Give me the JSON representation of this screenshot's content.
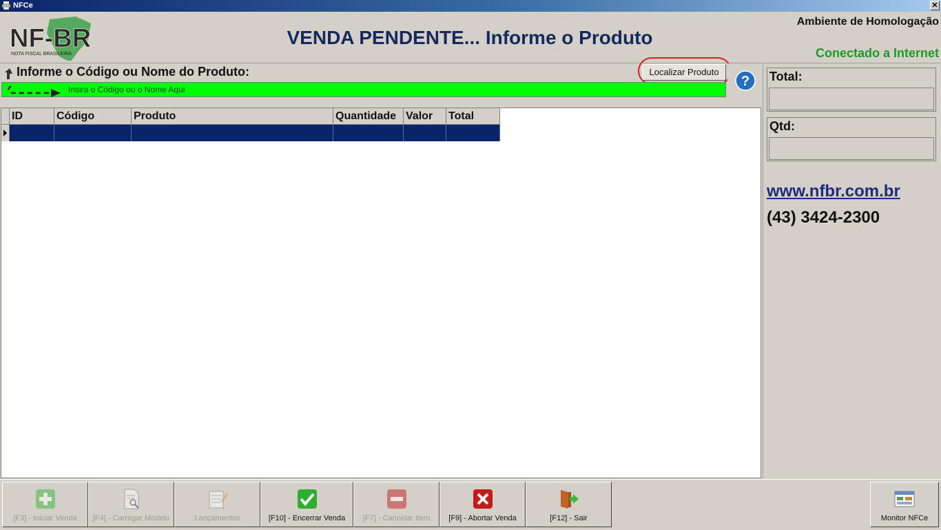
{
  "window": {
    "title": "NFCe",
    "close_glyph": "✕"
  },
  "header": {
    "logo_text": "NF-BR",
    "logo_subtext": "NOTA FISCAL BRASILEIRA",
    "title": "VENDA PENDENTE... Informe o Produto",
    "environment": "Ambiente de Homologação",
    "connection": "Conectado a Internet"
  },
  "search": {
    "label": "Informe o Código ou Nome do Produto:",
    "placeholder": "Insira o Código ou o Nome Aqui",
    "value": "",
    "locate_button": "Localizar Produto",
    "help_glyph": "?"
  },
  "grid": {
    "columns": [
      {
        "key": "id",
        "label": "ID"
      },
      {
        "key": "codigo",
        "label": "Código"
      },
      {
        "key": "produto",
        "label": "Produto"
      },
      {
        "key": "quantidade",
        "label": "Quantidade"
      },
      {
        "key": "valor",
        "label": "Valor"
      },
      {
        "key": "total",
        "label": "Total"
      }
    ],
    "rows": [
      {
        "id": "",
        "codigo": "",
        "produto": "",
        "quantidade": "",
        "valor": "",
        "total": ""
      }
    ]
  },
  "summary": {
    "total_label": "Total:",
    "total_value": "",
    "qtd_label": "Qtd:",
    "qtd_value": "",
    "website": "www.nfbr.com.br",
    "phone": "(43) 3424-2300"
  },
  "toolbar": {
    "buttons": [
      {
        "label": "[F3] - Iniciar Venda",
        "icon": "plus-icon",
        "enabled": false
      },
      {
        "label": "[F4] - Carregar Modelo",
        "icon": "document-search-icon",
        "enabled": false
      },
      {
        "label": "Lançamentos",
        "icon": "edit-list-icon",
        "enabled": false
      },
      {
        "label": "[F10] - Encerrar Venda",
        "icon": "check-icon",
        "enabled": true
      },
      {
        "label": "[F7] - Cancelar Item",
        "icon": "minus-icon",
        "enabled": false
      },
      {
        "label": "[F9] - Abortar Venda",
        "icon": "x-icon",
        "enabled": true
      },
      {
        "label": "[F12] - Sair",
        "icon": "exit-door-icon",
        "enabled": true
      }
    ],
    "monitor": {
      "label": "Monitor NFCe",
      "icon": "monitor-window-icon",
      "enabled": true
    }
  },
  "colors": {
    "accent_title": "#15295e",
    "connected": "#1d9a2a",
    "input_bg": "#00ff00",
    "selected_row": "#0a246a",
    "highlight_ring": "#d81f26"
  }
}
